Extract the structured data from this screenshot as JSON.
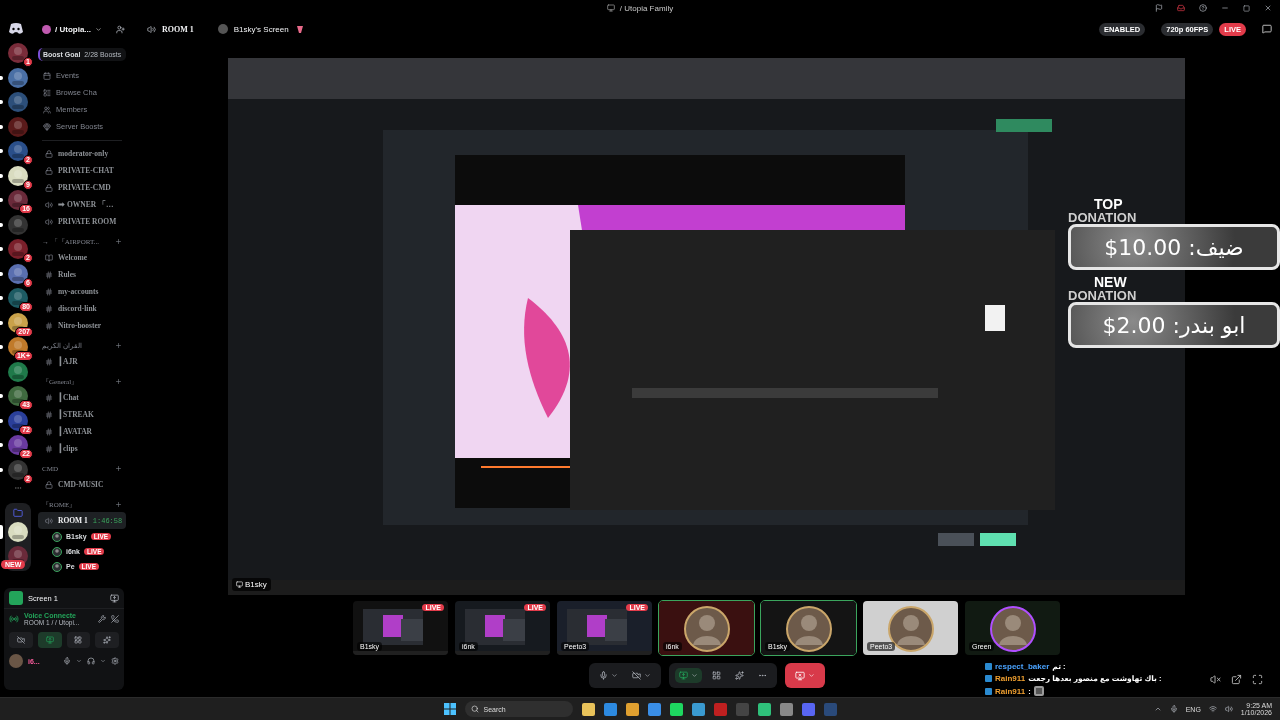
{
  "window": {
    "title": "/ Utopia Family"
  },
  "header": {
    "server": "/ Utopia...",
    "channel": "ROOM 1",
    "stream": "B1sky's Screen",
    "status": "ENABLED",
    "quality": "720p 60FPS",
    "live": "LIVE"
  },
  "servers": [
    {
      "badge": "1",
      "unread": false
    },
    {
      "unread": true
    },
    {
      "unread": true
    },
    {
      "unread": true
    },
    {
      "badge": "2",
      "unread": true
    },
    {
      "badge": "9",
      "unread": true
    },
    {
      "badge": "16",
      "unread": true
    },
    {
      "unread": true
    },
    {
      "badge": "2",
      "unread": true
    },
    {
      "badge": "6",
      "unread": true
    },
    {
      "badge": "80",
      "unread": true
    },
    {
      "badge": "207",
      "unread": true
    },
    {
      "badge": "1K+",
      "unread": true
    },
    {
      "unread": false
    },
    {
      "badge": "43",
      "unread": true
    },
    {
      "badge": "72",
      "unread": true
    },
    {
      "badge": "22",
      "unread": true
    },
    {
      "badge": "2",
      "unread": true
    }
  ],
  "folder_servers": [
    {
      "selected": true
    },
    {
      "selected": false,
      "badge": "NEW"
    }
  ],
  "sidebar": {
    "boost_label": "Boost Goal",
    "boost_progress": "2/28 Boosts",
    "nav": [
      {
        "kind": "events",
        "label": "Events"
      },
      {
        "kind": "browse",
        "label": "Browse Cha"
      },
      {
        "kind": "members",
        "label": "Members"
      },
      {
        "kind": "boosts",
        "label": "Server Boosts"
      }
    ],
    "groups": [
      {
        "channels": [
          {
            "kind": "locked",
            "name": "moderator-only"
          },
          {
            "kind": "locked",
            "name": "PRIVATE-CHAT"
          },
          {
            "kind": "locked",
            "name": "PRIVATE-CMD"
          },
          {
            "kind": "voice",
            "name": "➡ OWNER 「…"
          },
          {
            "kind": "voice",
            "name": "PRIVATE ROOM"
          }
        ]
      },
      {
        "category": "→ 「『AIRPORT...",
        "channels": [
          {
            "kind": "rules",
            "name": "Welcome"
          },
          {
            "kind": "text",
            "name": "Rules"
          },
          {
            "kind": "text",
            "name": "my-accounts"
          },
          {
            "kind": "text",
            "name": "discord-link"
          },
          {
            "kind": "text",
            "name": "Nitro-booster"
          }
        ]
      },
      {
        "category": "القران الكريم",
        "channels": [
          {
            "kind": "text",
            "name": "┃AJR"
          }
        ]
      },
      {
        "category": "『General』",
        "channels": [
          {
            "kind": "text",
            "name": "┃Chat"
          },
          {
            "kind": "text",
            "name": "┃STREAK"
          },
          {
            "kind": "text",
            "name": "┃AVATAR"
          },
          {
            "kind": "text",
            "name": "┃clips"
          }
        ]
      },
      {
        "category": "CMD",
        "channels": [
          {
            "kind": "locked",
            "name": "CMD-MUSIC"
          }
        ]
      },
      {
        "category": "『ROME』",
        "channels": [
          {
            "kind": "voice",
            "name": "ROOM 1",
            "timer": "1:46:58",
            "selected": true,
            "users": [
              {
                "name": "B1sky",
                "badge": "LIVE"
              },
              {
                "name": "i6nk",
                "badge": "LIVE"
              },
              {
                "name": "Pe",
                "badge": "LIVE"
              }
            ]
          }
        ]
      }
    ]
  },
  "panel": {
    "screen": "Screen 1",
    "voice_status": "Voice Connecte",
    "voice_room": "ROOM 1 / / Utopi...",
    "user": "i6..."
  },
  "stream": {
    "kind": "picture",
    "presenter": "B1sky"
  },
  "donations": [
    {
      "title": "TOP",
      "subtitle": "DONATION",
      "text": "ضيف: 10.00$"
    },
    {
      "title": "NEW",
      "subtitle": "DONATION",
      "text": "ابو بندر: 2.00$"
    }
  ],
  "tiles": [
    {
      "kind": "screen",
      "name": "B1sky",
      "badge": "LIVE",
      "speaking": false
    },
    {
      "kind": "screen",
      "name": "i6nk",
      "badge": "LIVE",
      "speaking": false
    },
    {
      "kind": "screen",
      "name": "Peeto3",
      "badge": "LIVE",
      "speaking": false
    },
    {
      "kind": "avatar",
      "name": "i6nk",
      "speaking": true
    },
    {
      "kind": "avatar",
      "name": "B1sky",
      "speaking": true
    },
    {
      "kind": "avatar",
      "name": "Peeto3",
      "speaking": false
    },
    {
      "kind": "avatar",
      "name": "Green",
      "speaking": false
    }
  ],
  "chat": [
    {
      "user": "respect_baker",
      "text": ": تم",
      "color": "#4aa3ff"
    },
    {
      "user": "Rain911",
      "text": ": باك تهاوشت مع منصور بعدها رجعت",
      "color": "#f0a030"
    },
    {
      "user": "Rain911",
      "text": ":",
      "color": "#f0a030",
      "kind": "sticker"
    }
  ],
  "taskbar": {
    "search": "Search",
    "language": "ENG",
    "time": "9:25 AM",
    "date": "1/10/2026"
  }
}
